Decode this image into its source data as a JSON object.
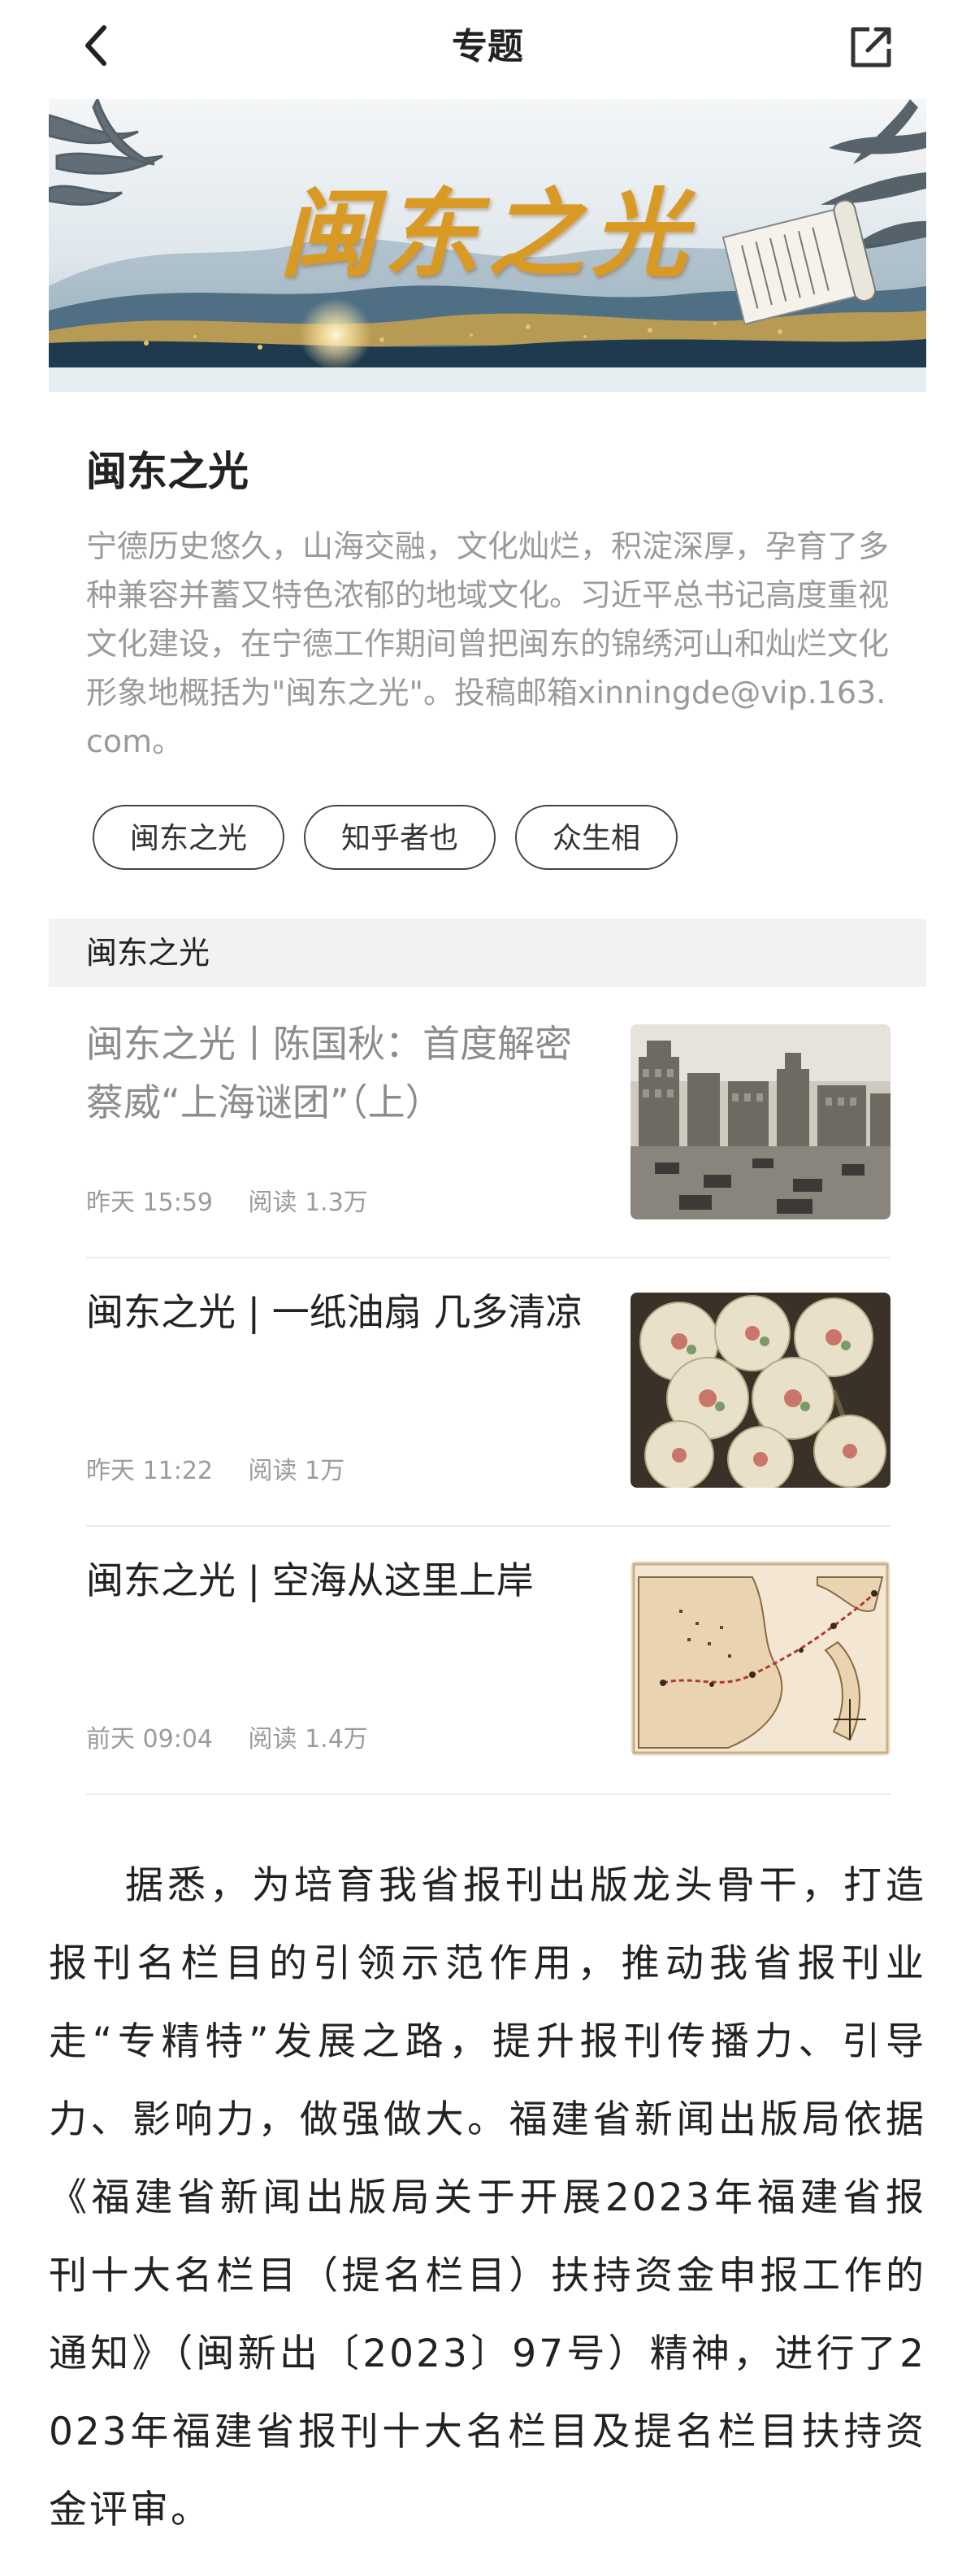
{
  "header": {
    "title": "专题",
    "back_icon": "chevron-left-icon",
    "share_icon": "share-icon"
  },
  "banner": {
    "title": "闽东之光"
  },
  "intro": {
    "title": "闽东之光",
    "description": "宁德历史悠久，山海交融，文化灿烂，积淀深厚，孕育了多种兼容并蓄又特色浓郁的地域文化。习近平总书记高度重视文化建设，在宁德工作期间曾把闽东的锦绣河山和灿烂文化形象地概括为\"闽东之光\"。投稿邮箱xinningde@vip.163.com。"
  },
  "tags": [
    "闽东之光",
    "知乎者也",
    "众生相"
  ],
  "section": {
    "label": "闽东之光"
  },
  "articles": [
    {
      "title": "闽东之光丨陈国秋：首度解密蔡威“上海谜团”（上）",
      "time": "昨天 15:59",
      "reads": "阅读 1.3万",
      "read": true
    },
    {
      "title": "闽东之光 | 一纸油扇 几多清凉",
      "time": "昨天 11:22",
      "reads": "阅读 1万",
      "read": false
    },
    {
      "title": "闽东之光 | 空海从这里上岸",
      "time": "前天 09:04",
      "reads": "阅读 1.4万",
      "read": false
    }
  ],
  "body": {
    "text": "据悉，为培育我省报刊出版龙头骨干，打造报刊名栏目的引领示范作用，推动我省报刊业走“专精特”发展之路，提升报刊传播力、引导力、影响力，做强做大。福建省新闻出版局依据《福建省新闻出版局关于开展2023年福建省报刊十大名栏目（提名栏目）扶持资金申报工作的通知》（闽新出〔2023〕97号）精神，进行了2023年福建省报刊十大名栏目及提名栏目扶持资金评审。"
  }
}
